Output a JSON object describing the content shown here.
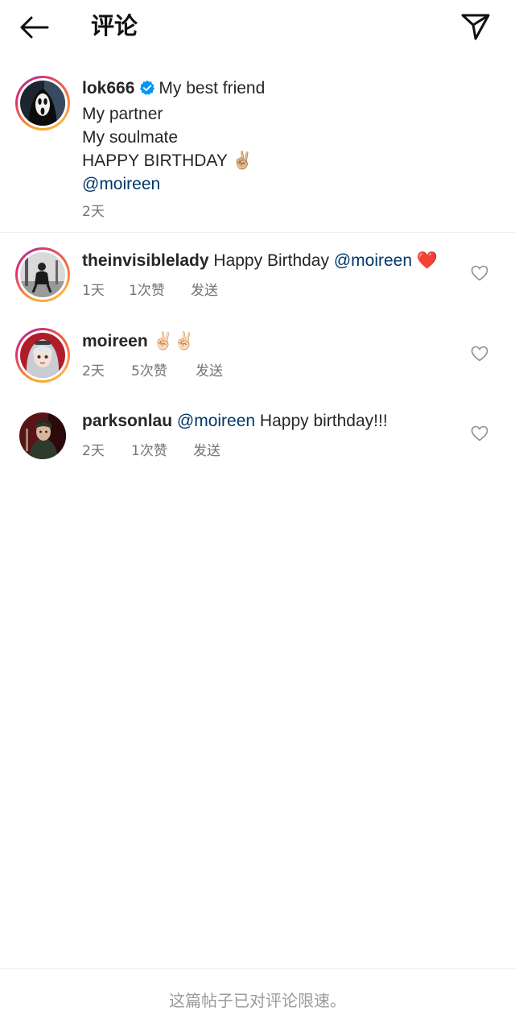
{
  "header": {
    "title": "评论",
    "back_icon": "arrow-left-icon",
    "share_icon": "paper-plane-icon"
  },
  "post": {
    "username": "lok666",
    "verified": true,
    "lines": [
      "My best friend",
      "My partner",
      "My soulmate",
      "HAPPY BIRTHDAY ✌🏼"
    ],
    "mention": "@moireen",
    "time": "2天"
  },
  "comments": [
    {
      "username": "theinvisiblelady",
      "text": "Happy Birthday",
      "mention": "@moireen",
      "emoji": "❤️",
      "time": "1天",
      "likes": "1次赞",
      "reply": "发送"
    },
    {
      "username": "moireen",
      "text": "",
      "mention": "",
      "emoji": "✌🏻✌🏻",
      "time": "2天",
      "likes": "5次赞",
      "reply": "发送"
    },
    {
      "username": "parksonlau",
      "text": "Happy birthday!!!",
      "mention": "@moireen",
      "emoji": "",
      "time": "2天",
      "likes": "1次赞",
      "reply": "发送"
    }
  ],
  "footer": {
    "notice": "这篇帖子已对评论限速。"
  },
  "colors": {
    "mention": "#00376b",
    "verified_badge": "#0095f6",
    "heart_emoji": "#e0245e",
    "meta_text": "#737373"
  }
}
